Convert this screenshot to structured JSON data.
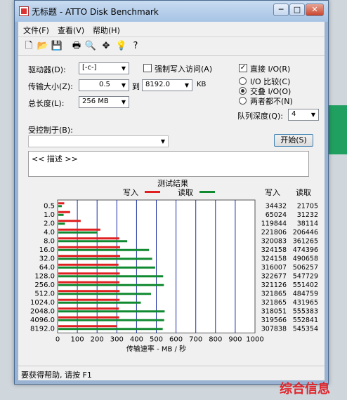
{
  "window": {
    "title": "无标题 - ATTO Disk Benchmark",
    "min": "─",
    "max": "□",
    "close": "✕"
  },
  "menu": [
    "文件(F)",
    "查看(V)",
    "帮助(H)"
  ],
  "toolbar_icons": [
    "new-file-icon",
    "open-folder-icon",
    "save-icon",
    "print-icon",
    "print-preview-icon",
    "move-icon",
    "help-icon",
    "context-help-icon"
  ],
  "toolbar_glyphs": [
    "🗋",
    "📂",
    "💾",
    "🖶",
    "🔍",
    "✥",
    "💡",
    "?"
  ],
  "settings": {
    "drive_label": "驱动器(D):",
    "drive_value": "[-c-]",
    "transfer_label": "传输大小(Z):",
    "transfer_from": "0.5",
    "transfer_to_label": "到",
    "transfer_to": "8192.0",
    "transfer_unit": "KB",
    "length_label": "总长度(L):",
    "length_value": "256 MB",
    "force_write_label": "强制写入访问(A)",
    "force_write_checked": false,
    "direct_io_label": "直接 I/O(R)",
    "direct_io_checked": true,
    "io_compare_label": "I/O 比较(C)",
    "overlapped_io_label": "交叠 I/O(O)",
    "neither_label": "两者都不(N)",
    "selected_mode": "overlapped",
    "queue_label": "队列深度(Q):",
    "queue_value": "4",
    "controlled_by_label": "受控制于(B):",
    "controlled_by_value": "",
    "start_button": "开始(S)",
    "description": "<< 描述 >>"
  },
  "chart_data": {
    "type": "bar",
    "title": "测试结果",
    "legend": [
      {
        "name": "写入",
        "color": "#e02020"
      },
      {
        "name": "读取",
        "color": "#108a30"
      }
    ],
    "xlabel": "传输速率 - MB / 秒",
    "xlim": [
      0,
      1000
    ],
    "xticks": [
      0,
      100,
      200,
      300,
      400,
      500,
      600,
      700,
      800,
      900,
      1000
    ],
    "categories": [
      "0.5",
      "1.0",
      "2.0",
      "4.0",
      "8.0",
      "16.0",
      "32.0",
      "64.0",
      "128.0",
      "256.0",
      "512.0",
      "1024.0",
      "2048.0",
      "4096.0",
      "8192.0"
    ],
    "series": [
      {
        "name": "写入",
        "color": "#e02020",
        "values": [
          33.6,
          63.5,
          117.0,
          216.6,
          312.6,
          316.6,
          316.6,
          308.6,
          315.1,
          313.6,
          314.3,
          314.3,
          310.6,
          312.1,
          300.6
        ]
      },
      {
        "name": "读取",
        "color": "#108a30",
        "values": [
          21.2,
          30.5,
          37.2,
          201.6,
          352.8,
          463.4,
          479.2,
          494.4,
          534.9,
          538.5,
          473.4,
          421.7,
          542.4,
          539.9,
          532.6
        ]
      }
    ],
    "table_headers": [
      "写入",
      "读取"
    ],
    "table_write": [
      "34432",
      "65024",
      "119844",
      "221806",
      "320083",
      "324158",
      "324158",
      "316007",
      "322677",
      "321126",
      "321865",
      "321865",
      "318051",
      "319566",
      "307838"
    ],
    "table_read": [
      "21705",
      "31232",
      "38114",
      "206446",
      "361265",
      "474396",
      "490658",
      "506257",
      "547729",
      "551402",
      "484759",
      "431965",
      "555383",
      "552841",
      "545354"
    ]
  },
  "status": "要获得帮助, 请按 F1",
  "watermark": "综合信息"
}
